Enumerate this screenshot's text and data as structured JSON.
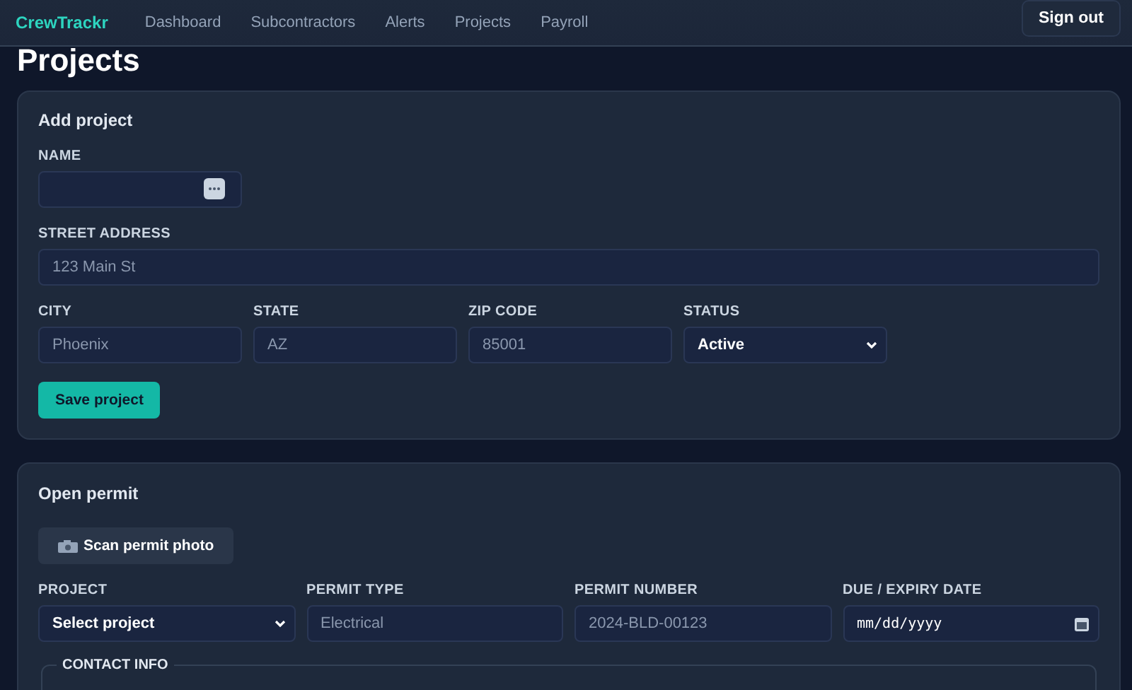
{
  "nav": {
    "brand": "CrewTrackr",
    "links": [
      "Dashboard",
      "Subcontractors",
      "Alerts",
      "Projects",
      "Payroll"
    ],
    "sign_out": "Sign out"
  },
  "page_title": "Projects",
  "add_project": {
    "title": "Add project",
    "name_field": {
      "kind": "text",
      "label": "NAME",
      "has_autofill": true
    },
    "address_field": {
      "kind": "text",
      "label": "STREET ADDRESS",
      "placeholder": "123 Main St"
    },
    "fields": [
      {
        "kind": "text",
        "label": "CITY",
        "placeholder": "Phoenix"
      },
      {
        "kind": "text",
        "label": "STATE",
        "placeholder": "AZ"
      },
      {
        "kind": "text",
        "label": "ZIP CODE",
        "placeholder": "85001"
      },
      {
        "kind": "select",
        "label": "STATUS",
        "value": "Active"
      }
    ],
    "save_button": "Save project"
  },
  "open_permit": {
    "title": "Open permit",
    "scan_button": "Scan permit photo",
    "fields": [
      {
        "kind": "select",
        "label": "PROJECT",
        "value": "Select project"
      },
      {
        "kind": "text",
        "label": "PERMIT TYPE",
        "placeholder": "Electrical"
      },
      {
        "kind": "text",
        "label": "PERMIT NUMBER",
        "placeholder": "2024-BLD-00123"
      },
      {
        "kind": "date",
        "label": "DUE / EXPIRY DATE",
        "value": "mm/dd/yyyy"
      }
    ],
    "contact_legend": "CONTACT INFO"
  }
}
